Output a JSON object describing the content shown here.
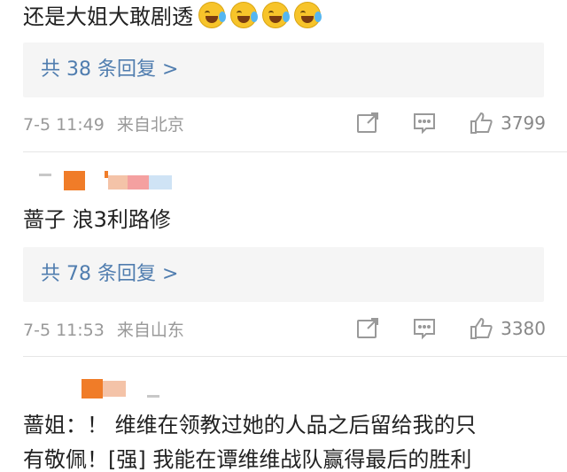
{
  "comments": [
    {
      "text": "还是大姐大敢剧透",
      "emoji_icons": [
        "crying-laughing-icon",
        "crying-laughing-icon",
        "crying-laughing-icon",
        "crying-laughing-icon"
      ],
      "reply_link": "共 38 条回复 >",
      "timestamp": "7-5 11:49",
      "source": "来自北京",
      "likes": "3799"
    },
    {
      "text": "蔷子 浪3利路修",
      "reply_link": "共 78 条回复 >",
      "timestamp": "7-5 11:53",
      "source": "来自山东",
      "likes": "3380"
    },
    {
      "text_line1": "蔷姐：！ 维维在领教过她的人品之后留给我的只",
      "text_line2": "有敬佩！[强] 我能在谭维维战队赢得最后的胜利"
    }
  ],
  "colors": {
    "link": "#507daf",
    "meta": "#999999",
    "reply_bg": "#f5f5f5",
    "avatar_orange": "#f07c28",
    "avatar_pink": "#f4a0a0",
    "avatar_blue": "#cfe3f5"
  }
}
